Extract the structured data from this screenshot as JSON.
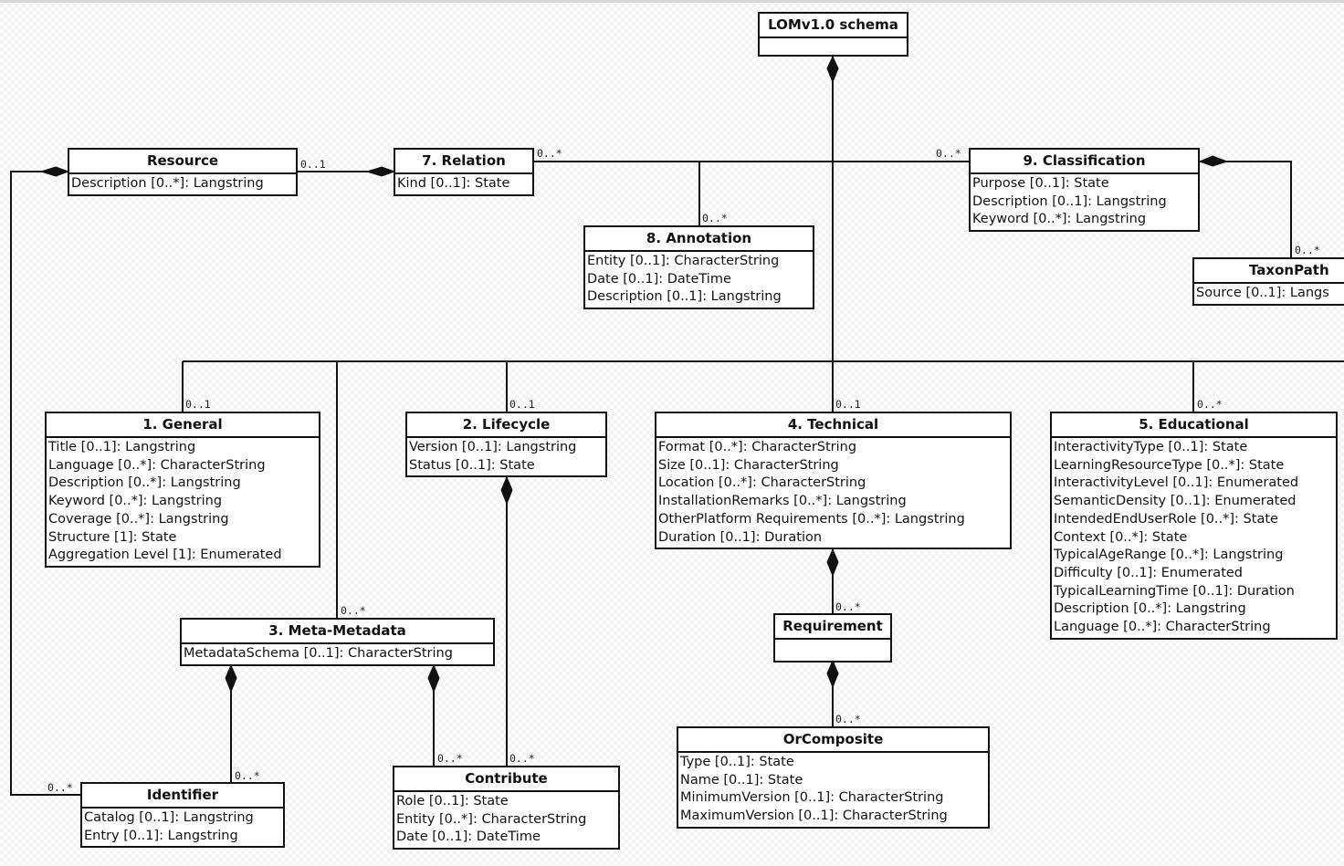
{
  "diagram": {
    "root": "LOMv1.0 schema",
    "classes": {
      "lom": {
        "name": "LOMv1.0 schema",
        "attributes": []
      },
      "resource": {
        "name": "Resource",
        "attributes": [
          "Description [0..*]: Langstring"
        ]
      },
      "relation": {
        "name": "7. Relation",
        "attributes": [
          "Kind [0..1]: State"
        ]
      },
      "annotation": {
        "name": "8. Annotation",
        "attributes": [
          "Entity [0..1]: CharacterString",
          "Date [0..1]: DateTime",
          "Description [0..1]: Langstring"
        ]
      },
      "classification": {
        "name": "9. Classification",
        "attributes": [
          "Purpose [0..1]: State",
          "Description [0..1]: Langstring",
          "Keyword [0..*]: Langstring"
        ]
      },
      "taxonpath": {
        "name": "TaxonPath",
        "attributes": [
          "Source [0..1]: Langs"
        ]
      },
      "general": {
        "name": "1. General",
        "attributes": [
          "Title [0..1]: Langstring",
          "Language [0..*]: CharacterString",
          "Description [0..*]: Langstring",
          "Keyword [0..*]: Langstring",
          "Coverage [0..*]: Langstring",
          "Structure [1]: State",
          "Aggregation Level [1]: Enumerated"
        ]
      },
      "lifecycle": {
        "name": "2. Lifecycle",
        "attributes": [
          "Version [0..1]: Langstring",
          "Status [0..1]: State"
        ]
      },
      "technical": {
        "name": "4. Technical",
        "attributes": [
          "Format [0..*]: CharacterString",
          "Size [0..1]: CharacterString",
          "Location [0..*]: CharacterString",
          "InstallationRemarks [0..*]: Langstring",
          "OtherPlatform Requirements [0..*]: Langstring",
          "Duration [0..1]: Duration"
        ]
      },
      "educational": {
        "name": "5. Educational",
        "attributes": [
          "InteractivityType [0..1]: State",
          "LearningResourceType [0..*]: State",
          "InteractivityLevel [0..1]: Enumerated",
          "SemanticDensity [0..1]: Enumerated",
          "IntendedEndUserRole [0..*]: State",
          "Context [0..*]: State",
          "TypicalAgeRange [0..*]: Langstring",
          "Difficulty [0..1]: Enumerated",
          "TypicalLearningTime [0..1]: Duration",
          "Description [0..*]: Langstring",
          "Language [0..*]: CharacterString"
        ]
      },
      "metametadata": {
        "name": "3. Meta-Metadata",
        "attributes": [
          "MetadataSchema [0..1]: CharacterString"
        ]
      },
      "requirement": {
        "name": "Requirement",
        "attributes": []
      },
      "orcomposite": {
        "name": "OrComposite",
        "attributes": [
          "Type [0..1]: State",
          "Name [0..1]: State",
          "MinimumVersion [0..1]: CharacterString",
          "MaximumVersion [0..1]: CharacterString"
        ]
      },
      "identifier": {
        "name": "Identifier",
        "attributes": [
          "Catalog [0..1]: Langstring",
          "Entry [0..1]: Langstring"
        ]
      },
      "contribute": {
        "name": "Contribute",
        "attributes": [
          "Role [0..1]: State",
          "Entity [0..*]: CharacterString",
          "Date [0..1]: DateTime"
        ]
      }
    },
    "multiplicities": {
      "resource_relation": "0..1",
      "relation_bus": "0..*",
      "annotation": "0..*",
      "classification": "0..*",
      "taxonpath": "0..*",
      "general": "0..1",
      "lifecycle": "0..1",
      "technical": "0..1",
      "educational": "0..*",
      "metametadata": "0..*",
      "requirement": "0..*",
      "orcomposite": "0..*",
      "identifier_meta": "0..*",
      "identifier_resource": "0..*",
      "contribute_meta": "0..*",
      "contribute_lifecycle": "0..*"
    }
  }
}
